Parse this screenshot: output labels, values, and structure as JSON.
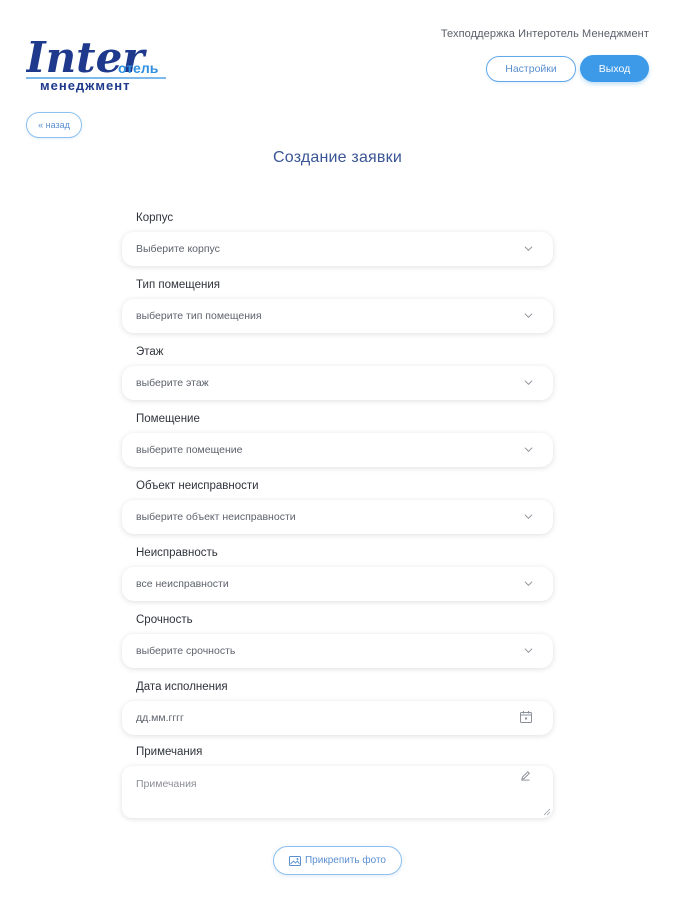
{
  "logo": {
    "word_main": "Inter",
    "word_sub": "отель",
    "word_bottom": "менеджмент",
    "colors": {
      "main": "#1f3a8c",
      "accent": "#2f8fe0"
    }
  },
  "header": {
    "support_text": "Техподдержка Интеротель Менеджмент",
    "settings_label": "Настройки",
    "exit_label": "Выход"
  },
  "nav": {
    "back_label": "« назад"
  },
  "page": {
    "title": "Создание заявки"
  },
  "form": {
    "fields": [
      {
        "label": "Корпус",
        "value": "Выберите корпус",
        "icon": "chevron-down-icon"
      },
      {
        "label": "Тип помещения",
        "value": "выберите тип помещения",
        "icon": "chevron-down-icon"
      },
      {
        "label": "Этаж",
        "value": "выберите этаж",
        "icon": "chevron-down-icon"
      },
      {
        "label": "Помещение",
        "value": "выберите помещение",
        "icon": "chevron-down-icon"
      },
      {
        "label": "Объект неисправности",
        "value": "выберите объект неисправности",
        "icon": "chevron-down-icon"
      },
      {
        "label": "Неисправность",
        "value": "все неисправности",
        "icon": "chevron-down-icon"
      },
      {
        "label": "Срочность",
        "value": "выберите срочность",
        "icon": "chevron-down-icon"
      },
      {
        "label": "Дата исполнения",
        "value": "дд.мм.гггг",
        "icon": "calendar-icon"
      }
    ],
    "notes": {
      "label": "Примечания",
      "placeholder": "Примечания"
    },
    "attach_photo_label": "Прикрепить фото"
  },
  "colors": {
    "accent": "#3d9ae8",
    "title": "#3a5596",
    "outline": "#8ec1ef"
  }
}
